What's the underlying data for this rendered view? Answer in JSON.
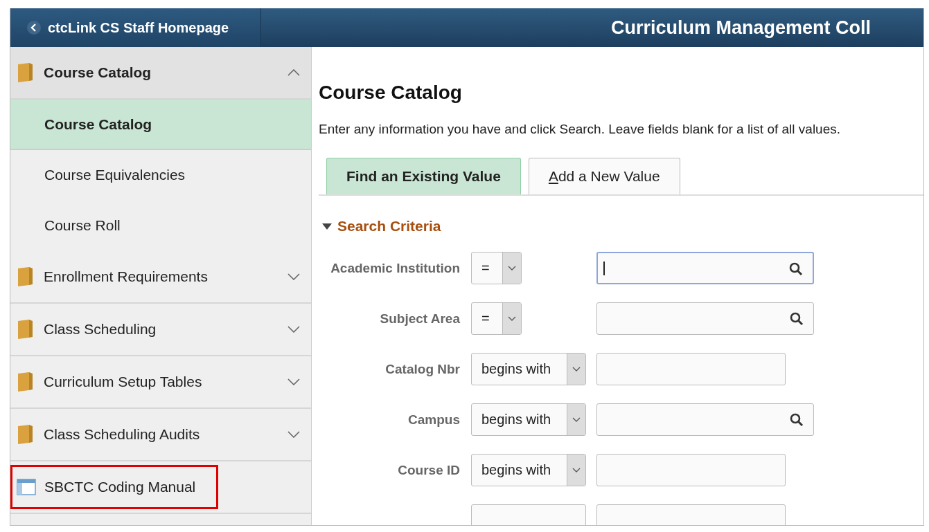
{
  "header": {
    "back_button": "ctcLink CS Staff Homepage",
    "title": "Curriculum Management Coll"
  },
  "sidebar": {
    "items": [
      {
        "kind": "folder",
        "label": "Course Catalog",
        "expanded": true,
        "children": [
          {
            "label": "Course Catalog",
            "selected": true
          },
          {
            "label": "Course Equivalencies",
            "selected": false
          },
          {
            "label": "Course Roll",
            "selected": false
          }
        ]
      },
      {
        "kind": "folder",
        "label": "Enrollment Requirements",
        "expanded": false
      },
      {
        "kind": "folder",
        "label": "Class Scheduling",
        "expanded": false
      },
      {
        "kind": "folder",
        "label": "Curriculum Setup Tables",
        "expanded": false
      },
      {
        "kind": "folder",
        "label": "Class Scheduling Audits",
        "expanded": false
      },
      {
        "kind": "page",
        "label": "SBCTC Coding Manual",
        "highlighted": true
      },
      {
        "kind": "cut"
      }
    ]
  },
  "main": {
    "title": "Course Catalog",
    "description": "Enter any information you have and click Search. Leave fields blank for a list of all values.",
    "tabs": [
      {
        "label": "Find an Existing Value",
        "selected": true,
        "underline_first": false
      },
      {
        "label": "Add a New Value",
        "selected": false,
        "underline_first": true
      }
    ],
    "section": {
      "title": "Search Criteria",
      "expanded": true
    },
    "rows": [
      {
        "kind": "field",
        "label": "Academic Institution",
        "operator": "=",
        "lookup": true,
        "focused": true
      },
      {
        "kind": "field",
        "label": "Subject Area",
        "operator": "=",
        "lookup": true,
        "focused": false
      },
      {
        "kind": "field",
        "label": "Catalog Nbr",
        "operator": "begins with",
        "lookup": false,
        "focused": false
      },
      {
        "kind": "field",
        "label": "Campus",
        "operator": "begins with",
        "lookup": true,
        "focused": false
      },
      {
        "kind": "field",
        "label": "Course ID",
        "operator": "begins with",
        "lookup": false,
        "focused": false
      },
      {
        "kind": "cut"
      }
    ]
  }
}
